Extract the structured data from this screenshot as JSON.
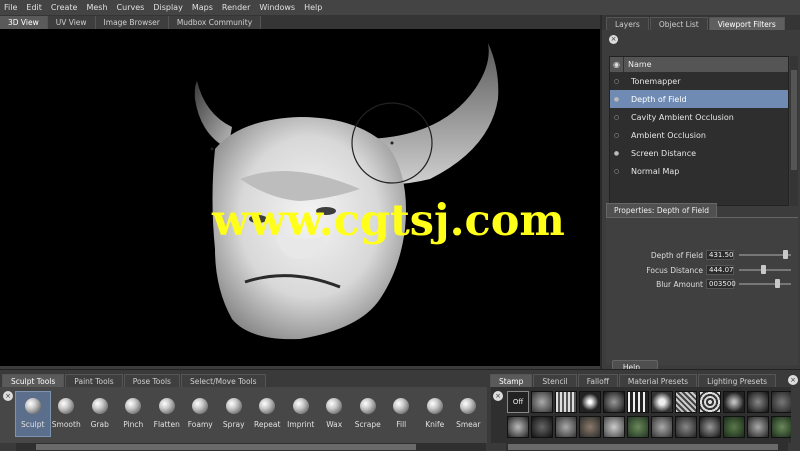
{
  "menu": [
    "File",
    "Edit",
    "Create",
    "Mesh",
    "Curves",
    "Display",
    "Maps",
    "Render",
    "Windows",
    "Help"
  ],
  "viewport_tabs": [
    "3D View",
    "UV View",
    "Image Browser",
    "Mudbox Community"
  ],
  "watermark": "www.cgtsj.com",
  "right_panel": {
    "tabs": [
      "Layers",
      "Object List",
      "Viewport Filters"
    ],
    "list_header": "Name",
    "filters": [
      "Tonemapper",
      "Depth of Field",
      "Cavity Ambient Occlusion",
      "Ambient Occlusion",
      "Screen Distance",
      "Normal Map"
    ],
    "selected_filter": "Depth of Field",
    "properties_tab": "Properties: Depth of Field",
    "properties": [
      {
        "label": "Depth of Field",
        "value": "431.50"
      },
      {
        "label": "Focus Distance",
        "value": "444.07"
      },
      {
        "label": "Blur Amount",
        "value": "003500"
      }
    ],
    "help_button": "Help..."
  },
  "tray": {
    "tool_tabs": [
      "Sculpt Tools",
      "Paint Tools",
      "Pose Tools",
      "Select/Move Tools"
    ],
    "tools": [
      "Sculpt",
      "Smooth",
      "Grab",
      "Pinch",
      "Flatten",
      "Foamy",
      "Spray",
      "Repeat",
      "Imprint",
      "Wax",
      "Scrape",
      "Fill",
      "Knife",
      "Smear"
    ],
    "active_tool": "Sculpt",
    "stamp_tabs": [
      "Stamp",
      "Stencil",
      "Falloff",
      "Material Presets",
      "Lighting Presets"
    ],
    "stamp_off_label": "Off"
  },
  "colors": {
    "selection": "#6f8bb3",
    "watermark": "#ffff1a",
    "viewport_bg": "#000000"
  }
}
